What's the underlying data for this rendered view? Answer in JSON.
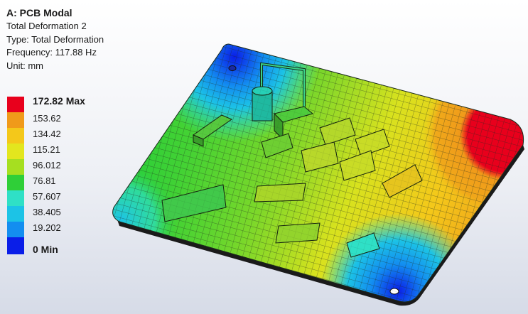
{
  "result": {
    "title": "A: PCB Modal",
    "name": "Total Deformation 2",
    "type": "Type: Total Deformation",
    "frequency": "Frequency: 117.88 Hz",
    "unit": "Unit: mm"
  },
  "legend": {
    "levels": [
      {
        "label": "172.82 Max",
        "color": "#e8001c",
        "bold": true
      },
      {
        "label": "153.62",
        "color": "#f09a1a",
        "bold": false
      },
      {
        "label": "134.42",
        "color": "#f4c81a",
        "bold": false
      },
      {
        "label": "115.21",
        "color": "#e3e61e",
        "bold": false
      },
      {
        "label": "96.012",
        "color": "#a6df20",
        "bold": false
      },
      {
        "label": "76.81",
        "color": "#2fcf38",
        "bold": false
      },
      {
        "label": "57.607",
        "color": "#2fe0c6",
        "bold": false
      },
      {
        "label": "38.405",
        "color": "#1cc3e6",
        "bold": false
      },
      {
        "label": "19.202",
        "color": "#138ef0",
        "bold": false
      },
      {
        "label": "0 Min",
        "color": "#0a1ee8",
        "bold": true
      }
    ]
  }
}
